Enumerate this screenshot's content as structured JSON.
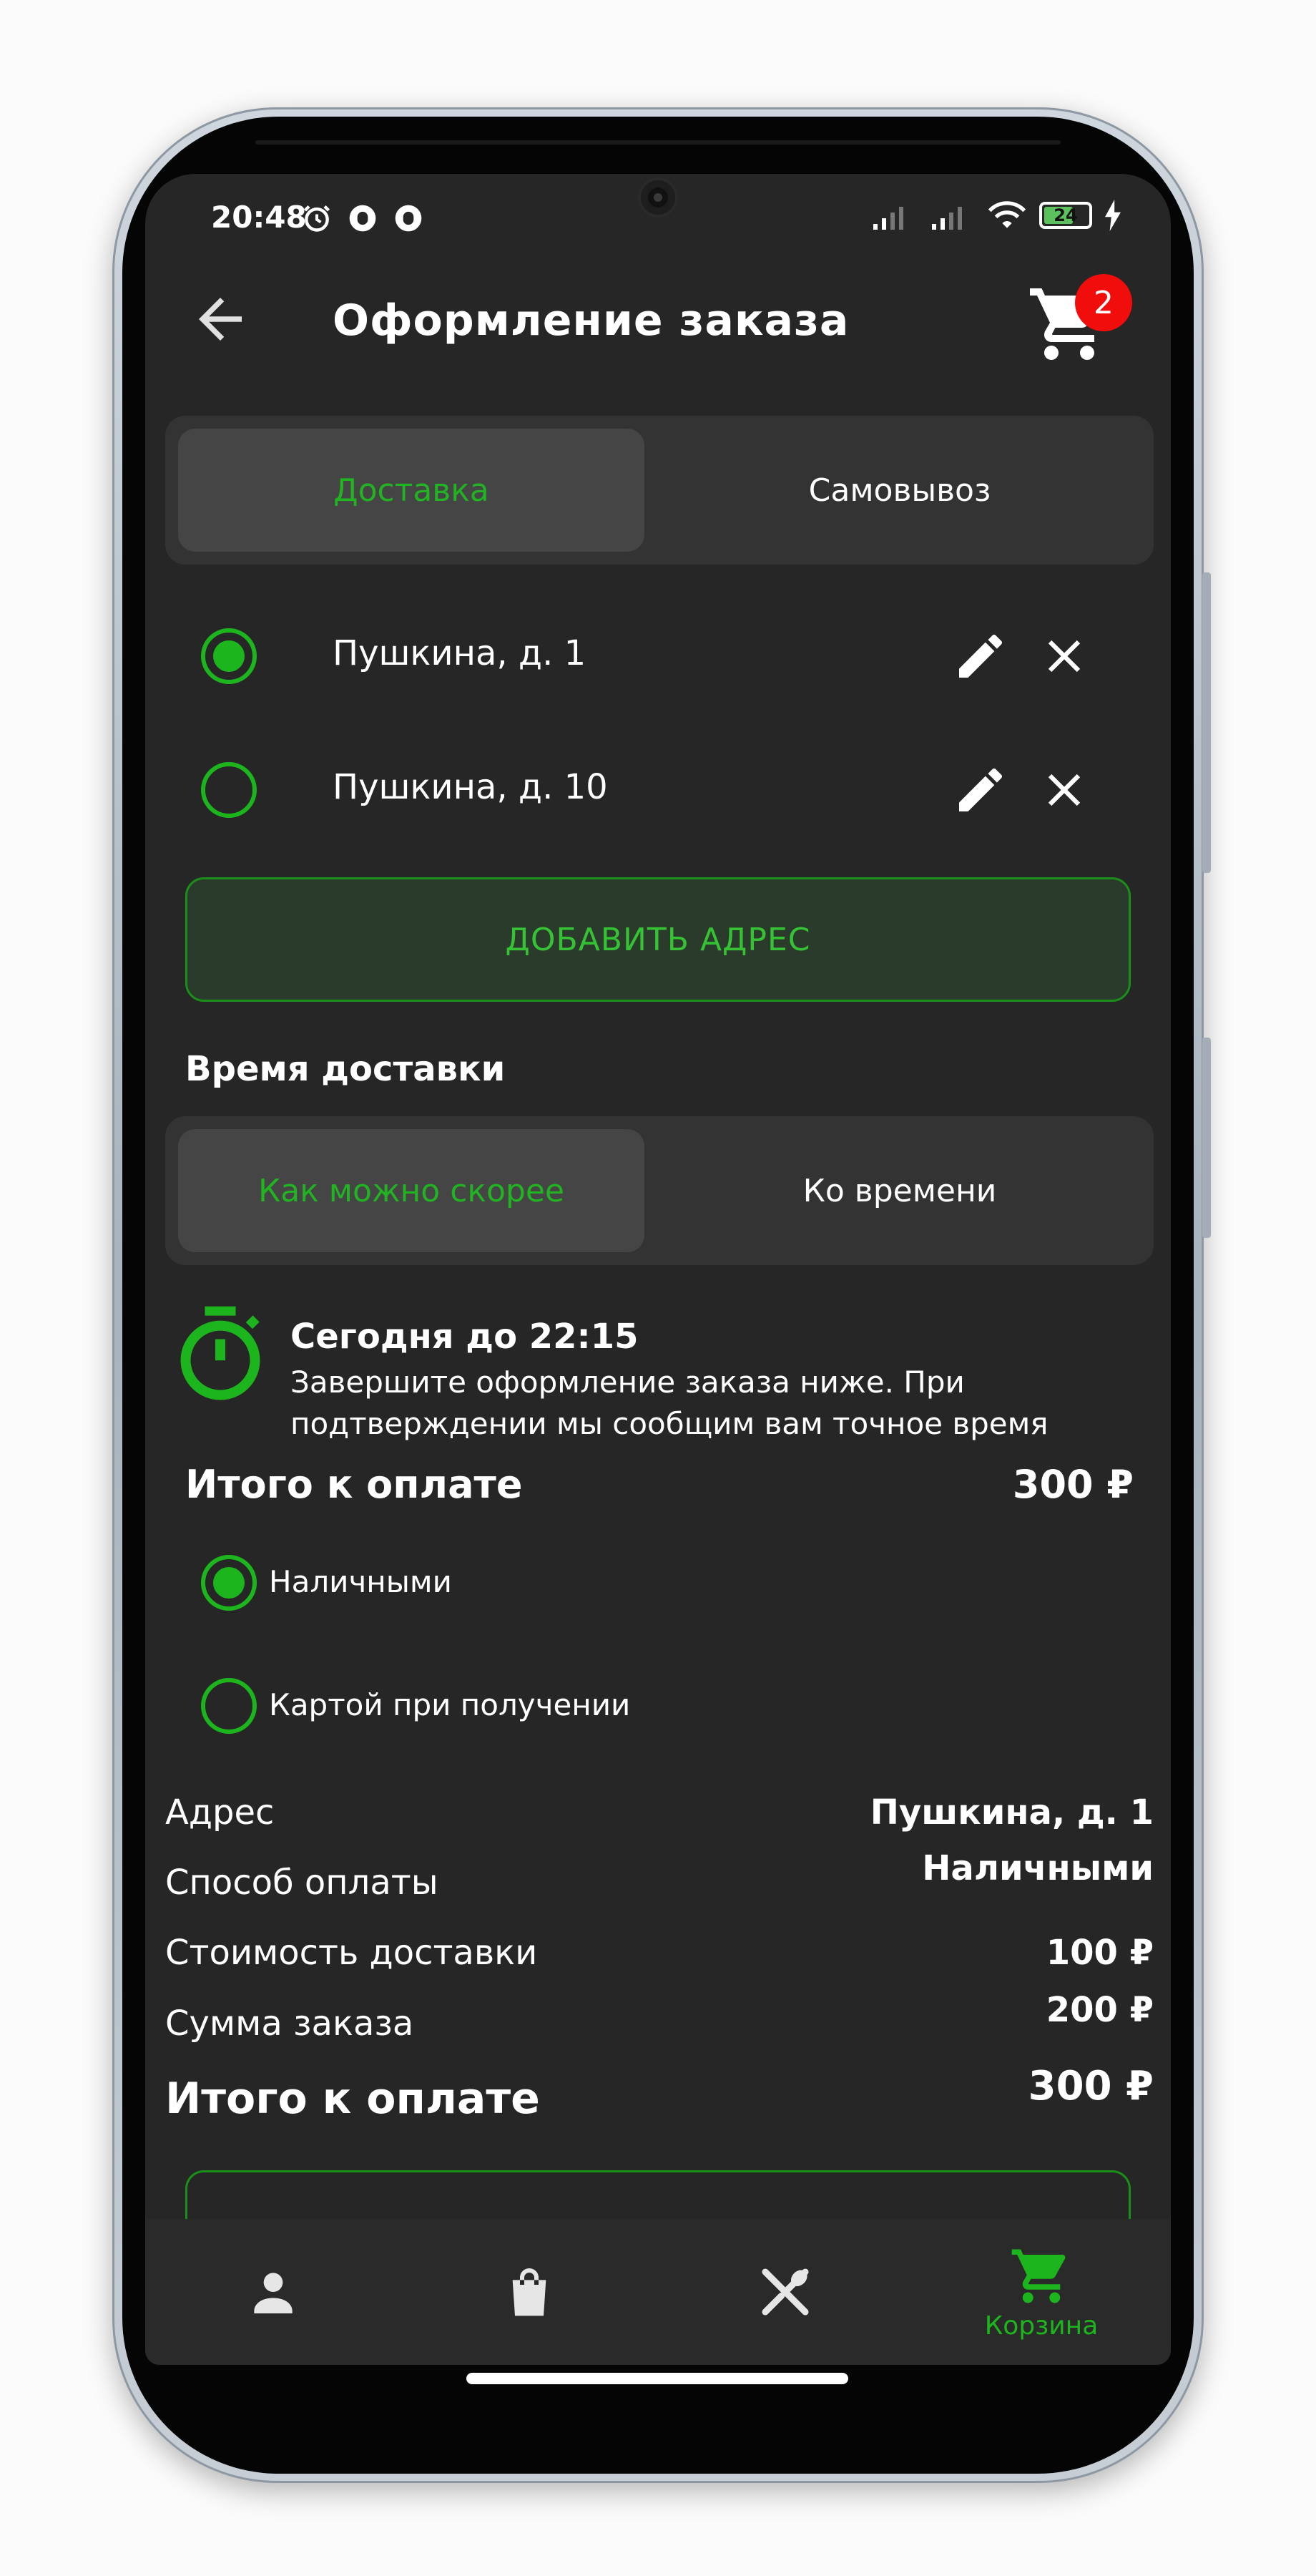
{
  "status_bar": {
    "time": "20:48",
    "battery": "24"
  },
  "app_bar": {
    "title": "Оформление заказа",
    "cart_badge": "2",
    "icons": [
      "arrow-back-icon",
      "cart-icon"
    ]
  },
  "delivery_tabs": {
    "active": "Доставка",
    "inactive": "Самовывоз"
  },
  "addresses": [
    {
      "label": "Пушкина, д. 1",
      "selected": true
    },
    {
      "label": "Пушкина, д. 10",
      "selected": false
    }
  ],
  "add_address_label": "ДОБАВИТЬ АДРЕС",
  "delivery_time": {
    "title": "Время доставки",
    "tab_active": "Как можно скорее",
    "tab_inactive": "Ко времени",
    "headline": "Сегодня до 22:15",
    "description": "Завершите оформление заказа ниже. При подтверждении мы сообщим вам точное время"
  },
  "payment": {
    "total_label": "Итого к оплате",
    "total_value": "300 ₽",
    "options": [
      {
        "label": "Наличными",
        "selected": true
      },
      {
        "label": "Картой при получении",
        "selected": false
      }
    ]
  },
  "summary": {
    "rows": [
      {
        "label": "Адрес",
        "value": "Пушкина, д. 1"
      },
      {
        "label": "Способ оплаты",
        "value": "Наличными"
      },
      {
        "label": "Стоимость доставки",
        "value": "100 ₽"
      },
      {
        "label": "Сумма заказа",
        "value": "200 ₽"
      }
    ],
    "total_label": "Итого к оплате",
    "total_value": "300 ₽"
  },
  "bottom_nav": {
    "items": [
      {
        "icon": "person-icon",
        "label": ""
      },
      {
        "icon": "shopping-bag-icon",
        "label": ""
      },
      {
        "icon": "restaurant-icon",
        "label": ""
      },
      {
        "icon": "cart-icon",
        "label": "Корзина",
        "active": true
      }
    ]
  },
  "colors": {
    "accent": "#1db51d",
    "background": "#262626",
    "surface": "#333333",
    "badge": "#f20d0d"
  }
}
